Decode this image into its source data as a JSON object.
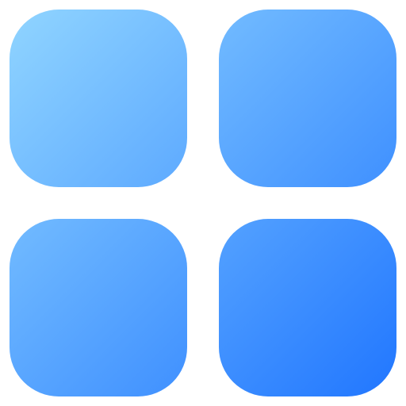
{
  "icon": {
    "name": "app-grid-icon",
    "gradient": {
      "start": "#93d7ff",
      "end": "#1e74ff"
    },
    "tiles": [
      {
        "name": "top-left-tile"
      },
      {
        "name": "top-right-tile"
      },
      {
        "name": "bottom-left-tile"
      },
      {
        "name": "bottom-right-tile"
      }
    ]
  }
}
